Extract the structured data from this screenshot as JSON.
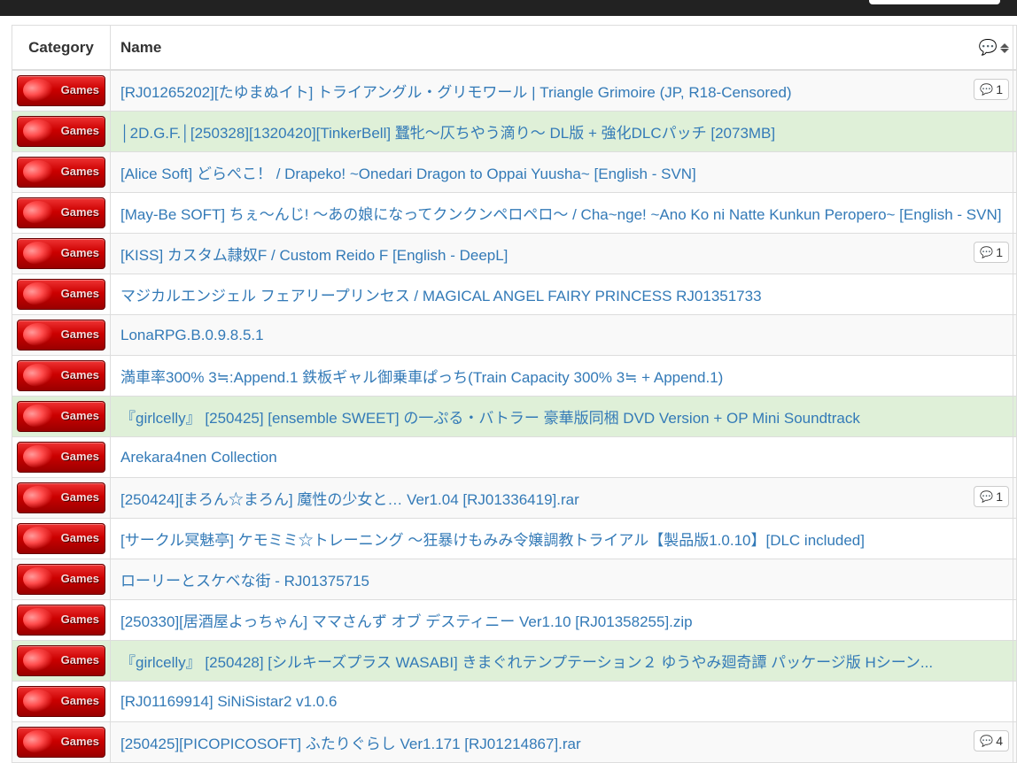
{
  "table": {
    "headers": {
      "category": "Category",
      "name": "Name"
    },
    "rows": [
      {
        "category": "Games",
        "name": "[RJ01265202][たゆまぬイト] トライアングル・グリモワール | Triangle Grimoire (JP, R18-Censored)",
        "comments": "1",
        "style": "default"
      },
      {
        "category": "Games",
        "name": "│2D.G.F.│[250328][1320420][TinkerBell] 蠶牝～仄ちやう滴り～ DL版 + 強化DLCパッチ [2073MB]",
        "comments": "",
        "style": "success"
      },
      {
        "category": "Games",
        "name": "[Alice Soft] どらぺこ！ / Drapeko! ~Onedari Dragon to Oppai Yuusha~ [English - SVN]",
        "comments": "",
        "style": "default"
      },
      {
        "category": "Games",
        "name": "[May-Be SOFT] ちぇ～んじ! ～あの娘になってクンクンペロペロ～ / Cha~nge! ~Ano Ko ni Natte Kunkun Peropero~ [English - SVN]",
        "comments": "",
        "style": "default"
      },
      {
        "category": "Games",
        "name": "[KISS] カスタム隷奴F / Custom Reido F [English - DeepL]",
        "comments": "1",
        "style": "default"
      },
      {
        "category": "Games",
        "name": "マジカルエンジェル フェアリープリンセス / MAGICAL ANGEL FAIRY PRINCESS RJ01351733",
        "comments": "",
        "style": "default"
      },
      {
        "category": "Games",
        "name": "LonaRPG.B.0.9.8.5.1",
        "comments": "",
        "style": "default"
      },
      {
        "category": "Games",
        "name": "満車率300% 3≒:Append.1 鉄板ギャル御乗車ぱっち(Train Capacity 300% 3≒ + Append.1)",
        "comments": "",
        "style": "default"
      },
      {
        "category": "Games",
        "name": "『girlcelly』 [250425] [ensemble SWEET] の一ぷる・バトラー 豪華版同梱 DVD Version + OP Mini Soundtrack",
        "comments": "",
        "style": "success"
      },
      {
        "category": "Games",
        "name": "Arekara4nen Collection",
        "comments": "",
        "style": "default"
      },
      {
        "category": "Games",
        "name": "[250424][まろん☆まろん] 魔性の少女と… Ver1.04 [RJ01336419].rar",
        "comments": "1",
        "style": "default"
      },
      {
        "category": "Games",
        "name": "[サークル冥魅亭] ケモミミ☆トレーニング ～狂暴けもみみ令嬢調教トライアル【製品版1.0.10】[DLC included]",
        "comments": "",
        "style": "default"
      },
      {
        "category": "Games",
        "name": "ローリーとスケベな街 - RJ01375715",
        "comments": "",
        "style": "default"
      },
      {
        "category": "Games",
        "name": "[250330][居酒屋よっちゃん] ママさんず オブ デスティニー Ver1.10 [RJ01358255].zip",
        "comments": "",
        "style": "default"
      },
      {
        "category": "Games",
        "name": "『girlcelly』 [250428] [シルキーズプラス WASABI] きまぐれテンプテーション２ ゆうやみ廻奇譚 パッケージ版 Hシーン...",
        "comments": "",
        "style": "success"
      },
      {
        "category": "Games",
        "name": "[RJ01169914] SiNiSistar2 v1.0.6",
        "comments": "",
        "style": "default"
      },
      {
        "category": "Games",
        "name": "[250425][PICOPICOSOFT] ふたりぐらし Ver1.171 [RJ01214867].rar",
        "comments": "4",
        "style": "default"
      }
    ]
  }
}
